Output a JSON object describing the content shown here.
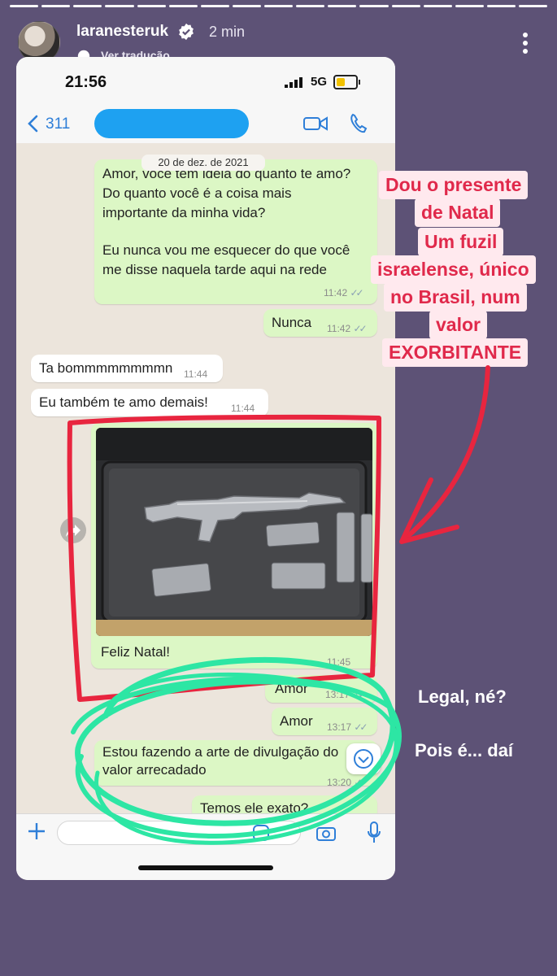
{
  "story": {
    "username": "laranesteruk",
    "time_ago": "2 min",
    "translate_label": "Ver tradução",
    "progress_segments": 17
  },
  "phone": {
    "status_time": "21:56",
    "network": "5G",
    "back_count": "311",
    "date_chip": "20 de dez. de 2021",
    "messages": [
      {
        "direction": "out",
        "lines": [
          "Amor, você tem ideia do quanto te amo?",
          "Do quanto você é a coisa mais",
          "importante da minha vida?",
          "",
          "Eu nunca vou me esquecer do que você",
          "me disse naquela tarde aqui na rede"
        ],
        "time": "11:42"
      },
      {
        "direction": "out",
        "text": "Nunca",
        "time": "11:42"
      },
      {
        "direction": "in",
        "text": "Ta bommmmmmmmn",
        "time": "11:44"
      },
      {
        "direction": "in",
        "text": "Eu também te amo demais!",
        "time": "11:44"
      },
      {
        "direction": "out",
        "type": "image",
        "caption": "Feliz Natal!",
        "time": "11:45"
      },
      {
        "direction": "out",
        "text": "Amor",
        "time": "13:17"
      },
      {
        "direction": "out",
        "text": "Amor",
        "time": "13:17"
      },
      {
        "direction": "out",
        "lines": [
          "Estou fazendo a arte de divulgação do",
          "valor arrecadado"
        ],
        "time": "13:20"
      },
      {
        "direction": "out",
        "text": "Temos ele exato?",
        "time": ""
      }
    ]
  },
  "captions": {
    "pink_lines": [
      "Dou o presente",
      "de Natal",
      "Um fuzil",
      "israelense, único",
      "no Brasil, num",
      "valor",
      "EXORBITANTE"
    ],
    "white_1": "Legal, né?",
    "white_2": "Pois é... daí"
  },
  "colors": {
    "background": "#5d5276",
    "outgoing_bubble": "#dcf7c5",
    "incoming_bubble": "#ffffff",
    "caption_text": "#e0294b",
    "caption_bg": "#ffe9ee",
    "red_markup": "#e8253f",
    "green_markup": "#2de6a4",
    "redaction_blue": "#1ea1f1"
  },
  "icons": [
    "verified-icon",
    "more-menu-icon",
    "translate-icon",
    "back-icon",
    "video-call-icon",
    "phone-call-icon",
    "forward-icon",
    "scroll-down-icon",
    "plus-icon",
    "sticker-icon",
    "camera-icon",
    "microphone-icon"
  ]
}
